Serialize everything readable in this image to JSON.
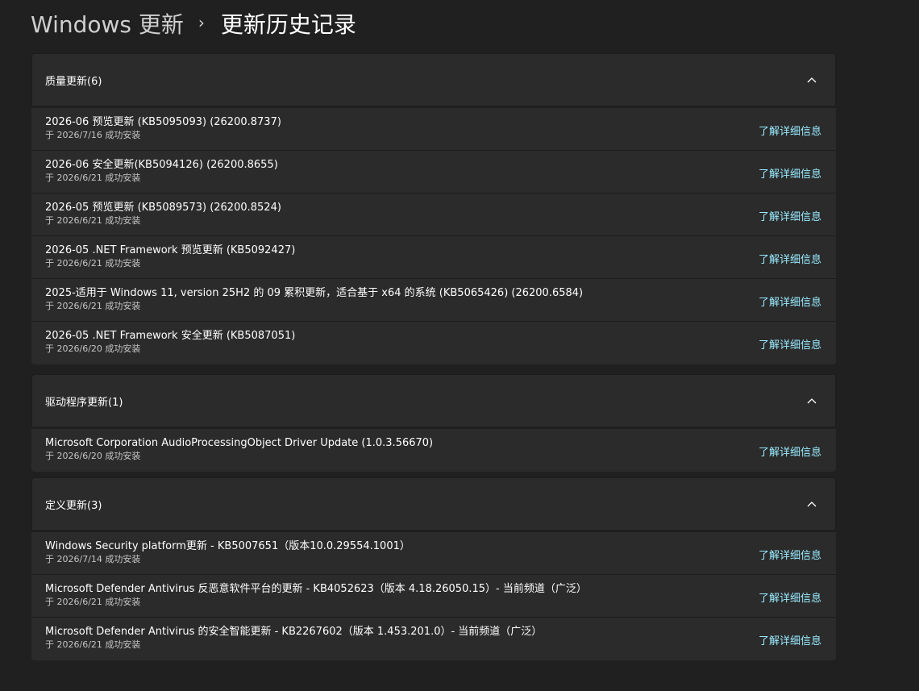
{
  "breadcrumb": {
    "parent": "Windows 更新",
    "separator": "›",
    "current": "更新历史记录"
  },
  "colors": {
    "background": "#202020",
    "card": "#2b2b2b",
    "link": "#99ebff"
  },
  "sections": [
    {
      "title": "质量更新(6)",
      "expanded": true,
      "icon": "chevron-up-icon",
      "items": [
        {
          "title": "2026-06 预览更新 (KB5095093) (26200.8737)",
          "installed": "于 2026/7/16 成功安装",
          "link": "了解详细信息"
        },
        {
          "title": "2026-06 安全更新(KB5094126) (26200.8655)",
          "installed": "于 2026/6/21 成功安装",
          "link": "了解详细信息"
        },
        {
          "title": "2026-05 预览更新 (KB5089573) (26200.8524)",
          "installed": "于 2026/6/21 成功安装",
          "link": "了解详细信息"
        },
        {
          "title": "2026-05 .NET Framework 预览更新 (KB5092427)",
          "installed": "于 2026/6/21 成功安装",
          "link": "了解详细信息"
        },
        {
          "title": "2025-适用于 Windows 11, version 25H2 的 09 累积更新，适合基于 x64 的系统 (KB5065426) (26200.6584)",
          "installed": "于 2026/6/21 成功安装",
          "link": "了解详细信息"
        },
        {
          "title": "2026-05 .NET Framework 安全更新 (KB5087051)",
          "installed": "于 2026/6/20 成功安装",
          "link": "了解详细信息"
        }
      ]
    },
    {
      "title": "驱动程序更新(1)",
      "expanded": true,
      "icon": "chevron-up-icon",
      "items": [
        {
          "title": "Microsoft Corporation AudioProcessingObject Driver Update (1.0.3.56670)",
          "installed": "于 2026/6/20 成功安装",
          "link": "了解详细信息"
        }
      ]
    },
    {
      "title": "定义更新(3)",
      "expanded": true,
      "icon": "chevron-up-icon",
      "items": [
        {
          "title": "Windows Security platform更新 - KB5007651（版本10.0.29554.1001）",
          "installed": "于 2026/7/14 成功安装",
          "link": "了解详细信息"
        },
        {
          "title": "Microsoft Defender Antivirus 反恶意软件平台的更新 - KB4052623（版本 4.18.26050.15）- 当前频道（广泛）",
          "installed": "于 2026/6/21 成功安装",
          "link": "了解详细信息"
        },
        {
          "title": "Microsoft Defender Antivirus 的安全智能更新 - KB2267602（版本 1.453.201.0）- 当前频道（广泛）",
          "installed": "于 2026/6/21 成功安装",
          "link": "了解详细信息"
        }
      ]
    }
  ]
}
